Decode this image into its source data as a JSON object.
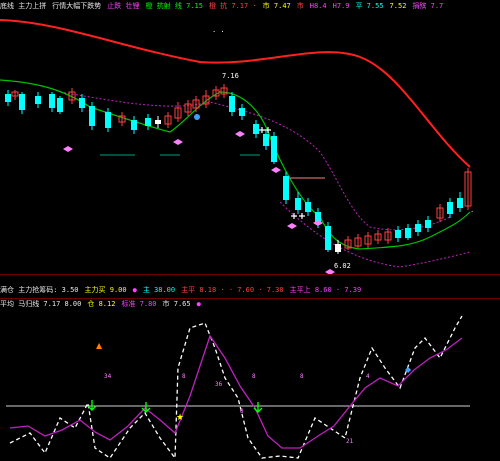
{
  "main_header": {
    "items": [
      {
        "text": "底线 主力上拼",
        "color": "#e8e8e8"
      },
      {
        "text": "行情大幅下跌势",
        "color": "#e8e8e8"
      },
      {
        "text": "止跌 壮锂",
        "color": "#ff40ff"
      },
      {
        "text": "橙 抗射 线 7.15",
        "color": "#00ff00"
      },
      {
        "text": "橙 抗 7.17 ·",
        "color": "#ff4040"
      },
      {
        "text": "市 7.47",
        "color": "#ffff00"
      },
      {
        "text": "市",
        "color": "#ff4040"
      },
      {
        "text": "H8.4",
        "color": "#ff40ff"
      },
      {
        "text": "H7.9",
        "color": "#ff40ff"
      },
      {
        "text": "平 7.55",
        "color": "#00ffff"
      },
      {
        "text": "7.52",
        "color": "#ffff00"
      },
      {
        "text": "捐殡 7.7",
        "color": "#ff40ff"
      }
    ]
  },
  "main_annotations": {
    "high_label": "7.16",
    "low_label": "6.02"
  },
  "sub_header": {
    "items": [
      {
        "text": "满仓 主力抢筹码: 3.50",
        "color": "#e8e8e8"
      },
      {
        "text": "主力买 9.00",
        "color": "#ffff00"
      },
      {
        "text": "●",
        "color": "#ff40ff"
      },
      {
        "text": "主 38.00",
        "color": "#00ffff"
      },
      {
        "text": "主平 8.18 · · 7.60 · 7.30",
        "color": "#ff4040"
      },
      {
        "text": "主平上 8.60 · 7.39",
        "color": "#ff40ff"
      }
    ]
  },
  "sub_header2": {
    "items": [
      {
        "text": "平均 马归线 7.17 8.00",
        "color": "#e8e8e8"
      },
      {
        "text": "仓 8.12",
        "color": "#ffff00"
      },
      {
        "text": "标准 7.80",
        "color": "#ff40ff"
      },
      {
        "text": "市 7.65",
        "color": "#e8e8e8"
      },
      {
        "text": "●",
        "color": "#ff40ff"
      }
    ]
  },
  "sub_annotations": {
    "labels": [
      "34",
      "8",
      "36",
      "8",
      "8",
      "4",
      "21",
      "8"
    ]
  }
}
